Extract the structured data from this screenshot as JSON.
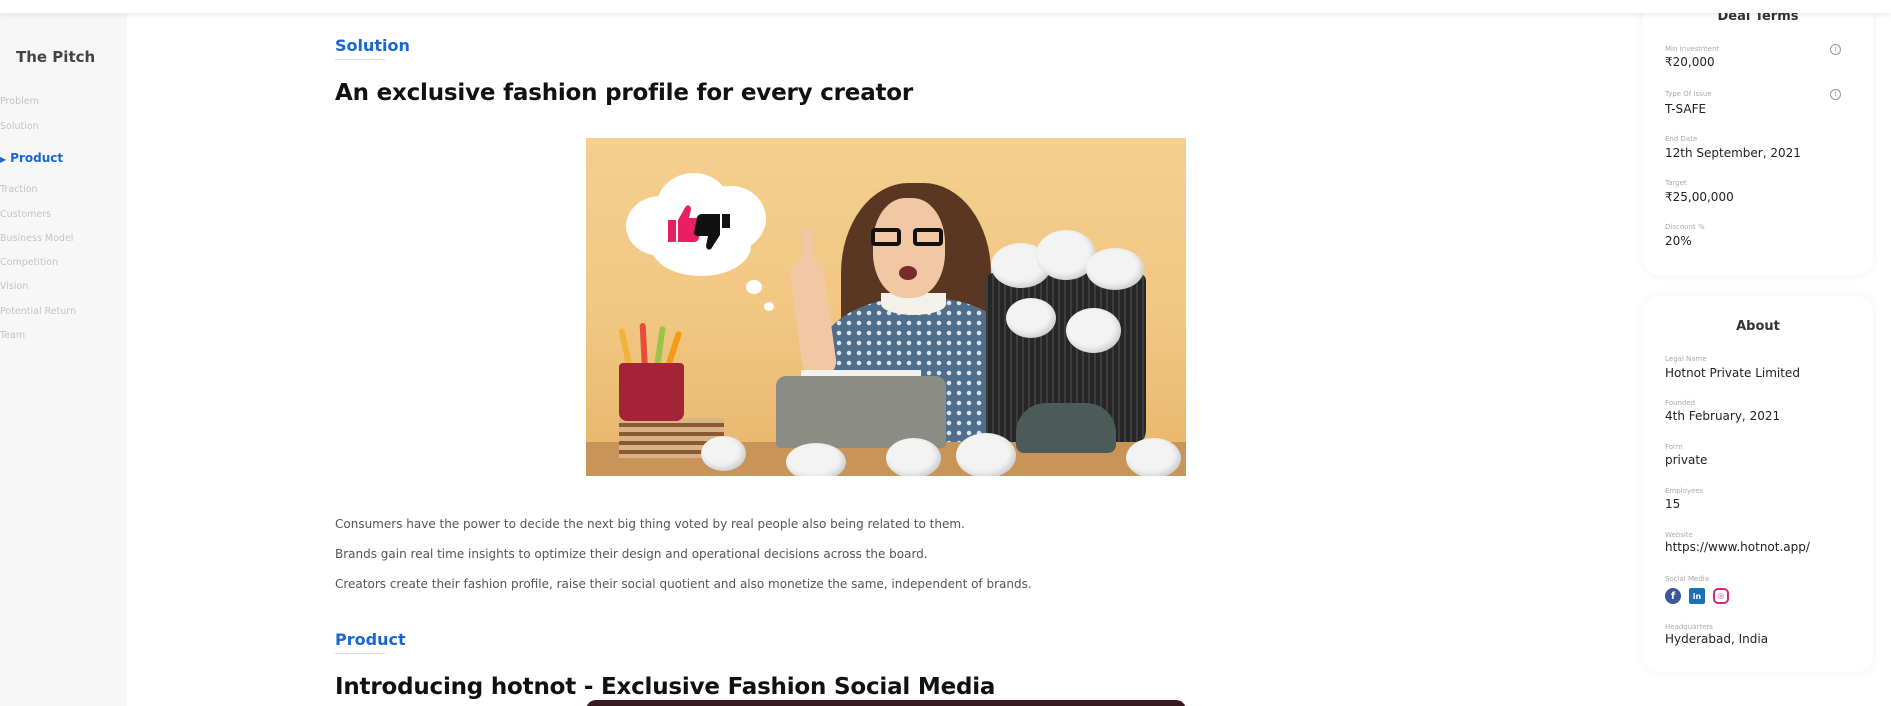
{
  "sidebar": {
    "title": "The Pitch",
    "items": [
      {
        "label": "Problem",
        "active": false
      },
      {
        "label": "Solution",
        "active": false
      },
      {
        "label": "Product",
        "active": true
      },
      {
        "label": "Traction",
        "active": false
      },
      {
        "label": "Customers",
        "active": false
      },
      {
        "label": "Business Model",
        "active": false
      },
      {
        "label": "Competition",
        "active": false
      },
      {
        "label": "Vision",
        "active": false
      },
      {
        "label": "Potential Return",
        "active": false
      },
      {
        "label": "Team",
        "active": false
      }
    ]
  },
  "main": {
    "solution": {
      "label": "Solution",
      "headline": "An exclusive fashion profile for every creator",
      "paragraphs": [
        "Consumers have the power to decide the next big thing voted by real people also being related to them.",
        "Brands gain real time insights to optimize their design and operational decisions across the board.",
        "Creators create their fashion profile, raise their social quotient and also monetize the same, independent of brands."
      ]
    },
    "product": {
      "label": "Product",
      "headline": "Introducing hotnot - Exclusive Fashion Social Media"
    }
  },
  "deal_terms": {
    "title": "Deal Terms",
    "fields": [
      {
        "label": "Min Investment",
        "value": "₹20,000"
      },
      {
        "label": "Type Of Issue",
        "value": "T-SAFE"
      },
      {
        "label": "End Date",
        "value": "12th September, 2021"
      },
      {
        "label": "Target",
        "value": "₹25,00,000"
      },
      {
        "label": "Discount %",
        "value": "20%"
      }
    ]
  },
  "about": {
    "title": "About",
    "fields": [
      {
        "label": "Legal Name",
        "value": "Hotnot Private Limited"
      },
      {
        "label": "Founded",
        "value": "4th February, 2021"
      },
      {
        "label": "Form",
        "value": "private"
      },
      {
        "label": "Employees",
        "value": "15"
      },
      {
        "label": "Website",
        "value": "https://www.hotnot.app/"
      }
    ],
    "social_label": "Social Media",
    "social_icons": [
      "facebook-icon",
      "linkedin-icon",
      "instagram-icon"
    ],
    "hq_label": "Headquarters",
    "hq_value": "Hyderabad, India"
  },
  "colors": {
    "accent": "#1967d2",
    "thumbs_up": "#e91e63",
    "thumbs_down": "#111111"
  }
}
